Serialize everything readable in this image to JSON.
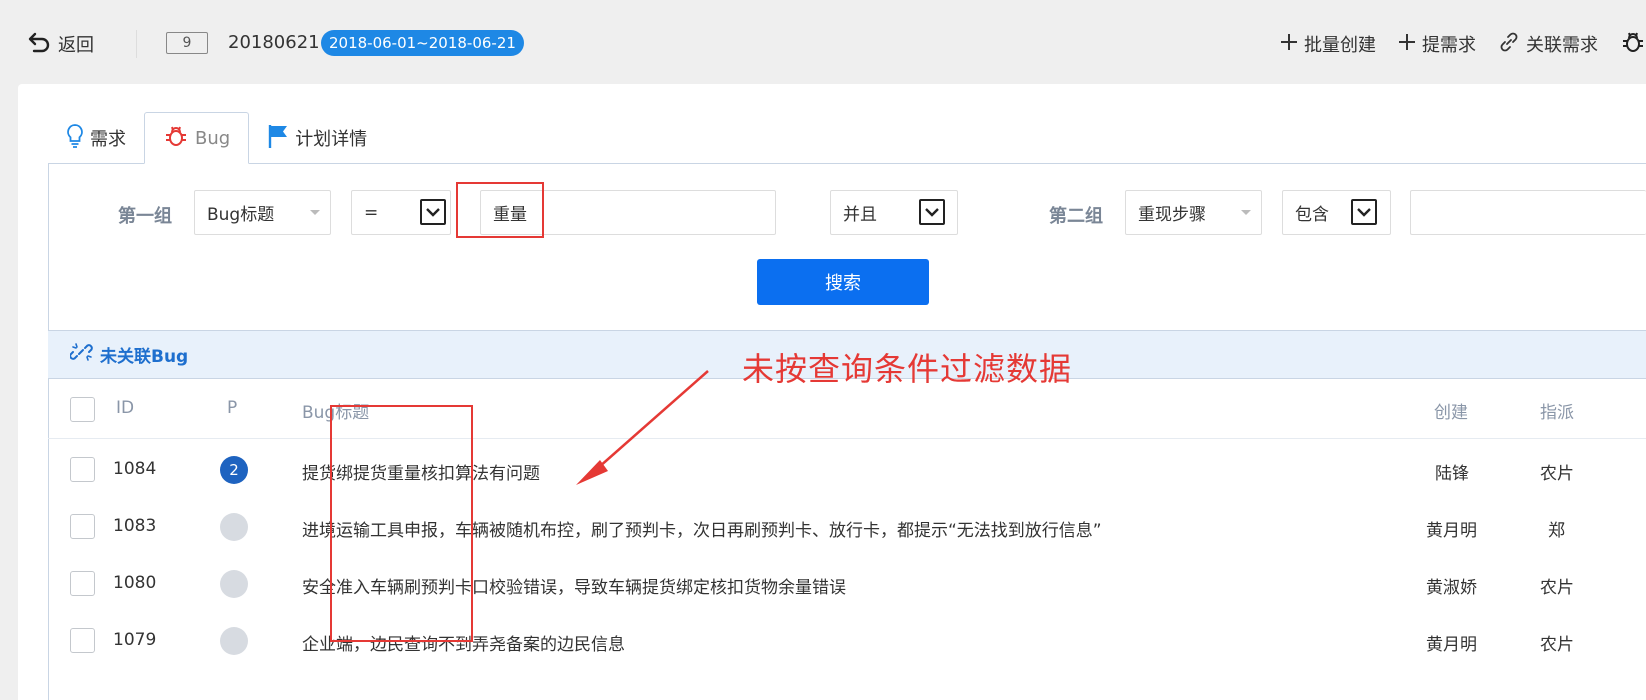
{
  "topbar": {
    "back_label": "返回",
    "plan_number": "9",
    "plan_name": "20180621",
    "date_range": "2018-06-01~2018-06-21",
    "actions": [
      {
        "label": "批量创建",
        "icon": "plus-icon"
      },
      {
        "label": "提需求",
        "icon": "plus-icon"
      },
      {
        "label": "关联需求",
        "icon": "link-icon"
      },
      {
        "label": "",
        "icon": "bug-icon"
      }
    ]
  },
  "tabs": [
    {
      "label": "需求",
      "icon": "lightbulb-icon",
      "active": false
    },
    {
      "label": "Bug",
      "icon": "bug-icon",
      "active": true
    },
    {
      "label": "计划详情",
      "icon": "flag-icon",
      "active": false
    }
  ],
  "filter": {
    "group1_label": "第一组",
    "group1_field": "Bug标题",
    "group1_operator": "=",
    "group1_value": "重量",
    "conjunction": "并且",
    "group2_label": "第二组",
    "group2_field": "重现步骤",
    "group2_operator": "包含",
    "group2_value": "",
    "search_button": "搜索"
  },
  "section": {
    "title": "未关联Bug",
    "icon": "unlink-icon"
  },
  "table": {
    "headers": {
      "id": "ID",
      "priority": "P",
      "title": "Bug标题",
      "creator": "创建",
      "assignee": "指派"
    },
    "rows": [
      {
        "id": "1084",
        "priority": "2",
        "title": "提货绑提货重量核扣算法有问题",
        "creator": "陆锋",
        "assignee": "农片"
      },
      {
        "id": "1083",
        "priority": "",
        "title": "进境运输工具申报，车辆被随机布控，刷了预判卡，次日再刷预判卡、放行卡，都提示“无法找到放行信息”",
        "creator": "黄月明",
        "assignee": "郑"
      },
      {
        "id": "1080",
        "priority": "",
        "title": "安全准入车辆刷预判卡口校验错误，导致车辆提货绑定核扣货物余量错误",
        "creator": "黄淑娇",
        "assignee": "农片"
      },
      {
        "id": "1079",
        "priority": "",
        "title": "企业端，边民查询不到弄尧备案的边民信息",
        "creator": "黄月明",
        "assignee": "农片"
      }
    ]
  },
  "annotation": {
    "text": "未按查询条件过滤数据",
    "color": "#e53935"
  },
  "colors": {
    "accent": "#0b6ff0",
    "priority_high": "#1e63c0",
    "section_title": "#1e6fce",
    "annotation": "#e53935"
  }
}
